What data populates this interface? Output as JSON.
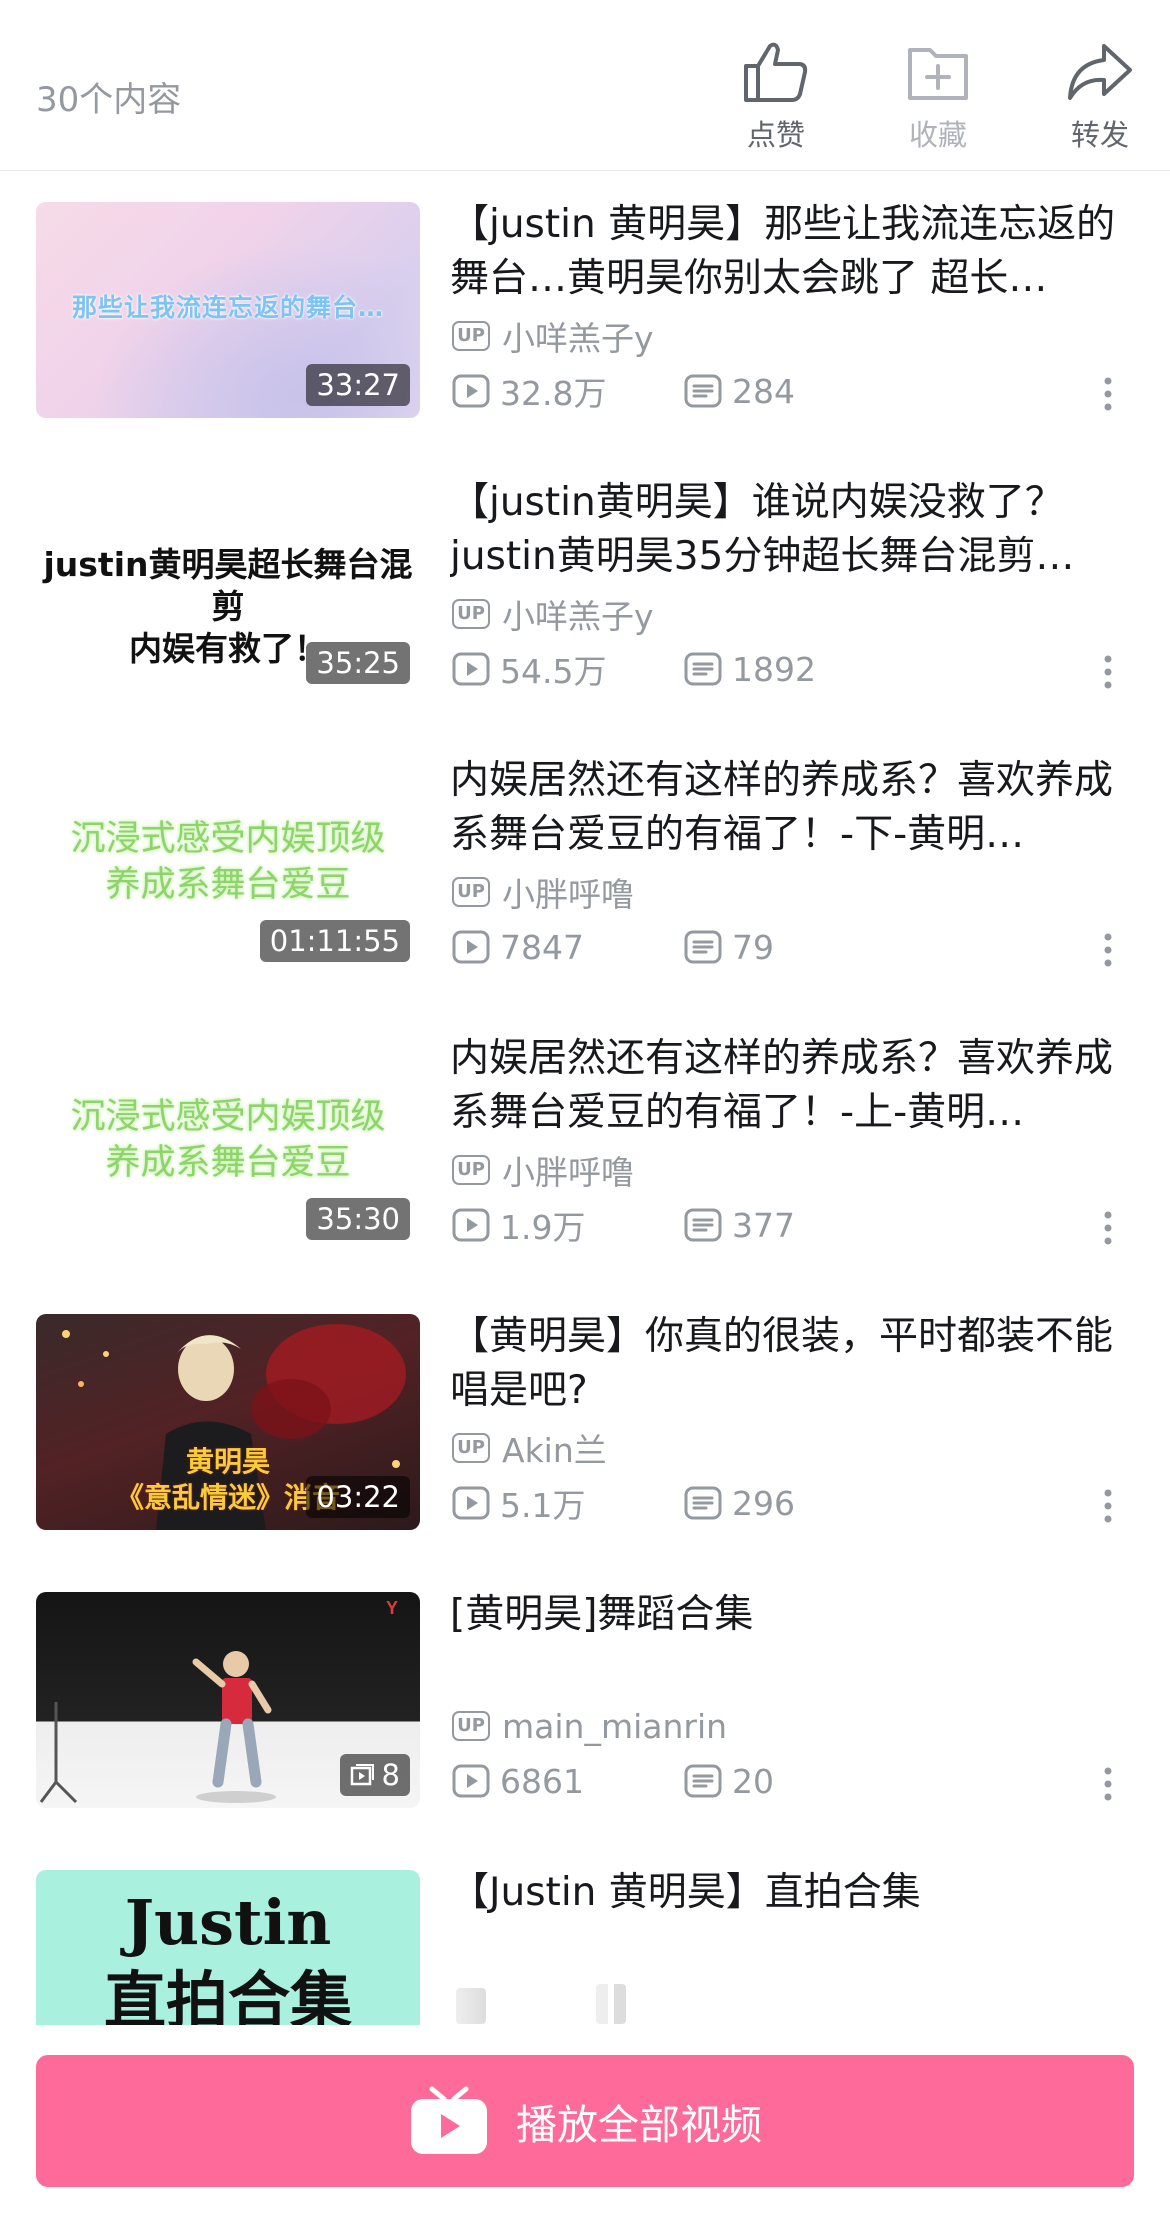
{
  "header": {
    "count": "30个内容",
    "actions": [
      {
        "label": "点赞",
        "icon": "thumbs-up-icon"
      },
      {
        "label": "收藏",
        "icon": "add-folder-icon"
      },
      {
        "label": "转发",
        "icon": "share-icon"
      }
    ]
  },
  "videos": [
    {
      "title": "【justin  黄明昊】那些让我流连忘返的舞台…黄明昊你别太会跳了    超长…",
      "thumb_caption": "那些让我流连忘返的舞台…",
      "duration": "33:27",
      "uploader": "小咩羔子y",
      "views": "32.8万",
      "comments": "284"
    },
    {
      "title": "【justin黄明昊】谁说内娱没救了？justin黄明昊35分钟超长舞台混剪…",
      "thumb_caption_1": "justin黄明昊超长舞台混剪",
      "thumb_caption_2": "内娱有救了！",
      "duration": "35:25",
      "uploader": "小咩羔子y",
      "views": "54.5万",
      "comments": "1892"
    },
    {
      "title": "内娱居然还有这样的养成系？喜欢养成系舞台爱豆的有福了！-下-黄明…",
      "thumb_caption_1": "沉浸式感受内娱顶级",
      "thumb_caption_2": "养成系舞台爱豆",
      "duration": "01:11:55",
      "uploader": "小胖呼噜",
      "views": "7847",
      "comments": "79"
    },
    {
      "title": "内娱居然还有这样的养成系？喜欢养成系舞台爱豆的有福了！-上-黄明…",
      "thumb_caption_1": "沉浸式感受内娱顶级",
      "thumb_caption_2": "养成系舞台爱豆",
      "duration": "35:30",
      "uploader": "小胖呼噜",
      "views": "1.9万",
      "comments": "377"
    },
    {
      "title": "【黄明昊】你真的很装，平时都装不能唱是吧?",
      "thumb_caption_1": "黄明昊",
      "thumb_caption_2": "《意乱情迷》消音",
      "duration": "03:22",
      "uploader": "Akin兰",
      "views": "5.1万",
      "comments": "296"
    },
    {
      "title": "[黄明昊]舞蹈合集",
      "duration": "8",
      "uploader": "main_mianrin",
      "views": "6861",
      "comments": "20"
    },
    {
      "title": "【Justin  黄明昊】直拍合集",
      "thumb_caption_1": "Justin",
      "thumb_caption_2": "直拍合集"
    }
  ],
  "footer": {
    "play_all_label": "播放全部视频"
  }
}
